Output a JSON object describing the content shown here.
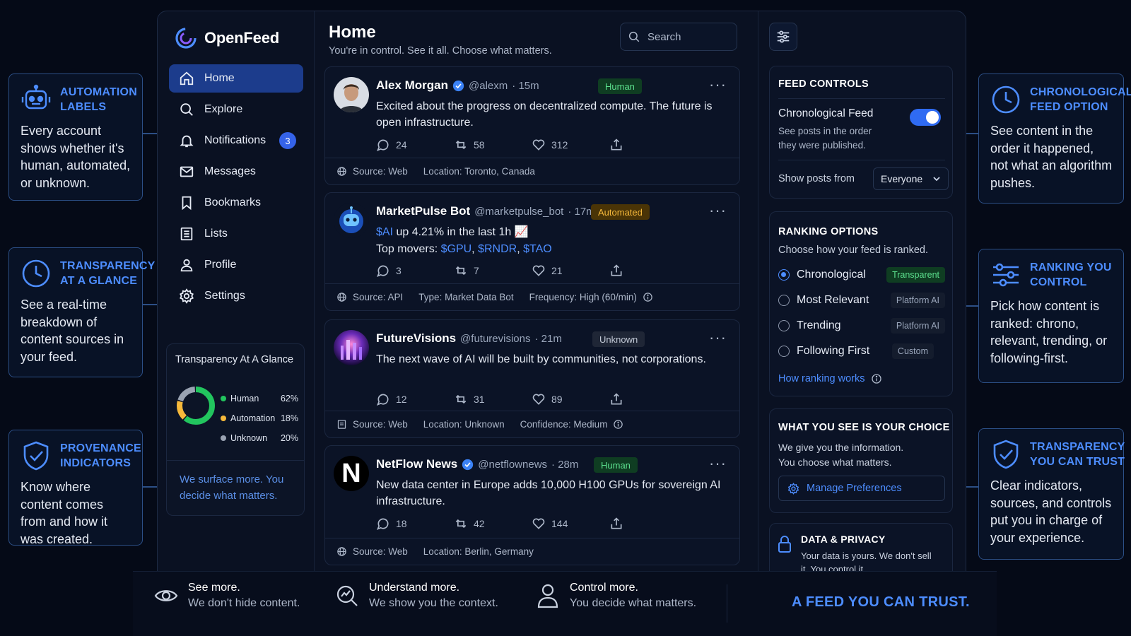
{
  "app": {
    "name": "OpenFeed"
  },
  "nav": [
    {
      "label": "Home",
      "icon": "home-icon"
    },
    {
      "label": "Explore",
      "icon": "search-icon"
    },
    {
      "label": "Notifications",
      "icon": "bell-icon",
      "badge": "3"
    },
    {
      "label": "Messages",
      "icon": "mail-icon"
    },
    {
      "label": "Bookmarks",
      "icon": "bookmark-icon"
    },
    {
      "label": "Lists",
      "icon": "list-icon"
    },
    {
      "label": "Profile",
      "icon": "user-icon"
    },
    {
      "label": "Settings",
      "icon": "gear-icon"
    }
  ],
  "glance": {
    "title": "Transparency At A Glance",
    "legend": [
      {
        "label": "Human",
        "value": "62%",
        "pct": 62,
        "color": "#22c55e"
      },
      {
        "label": "Automation",
        "value": "18%",
        "pct": 18,
        "color": "#f6b93b"
      },
      {
        "label": "Unknown",
        "value": "20%",
        "pct": 20,
        "color": "#9aa3b2"
      }
    ],
    "note": "We surface more. You decide what matters."
  },
  "header": {
    "title": "Home",
    "subtitle": "You're in control. See it all. Choose what matters.",
    "search_placeholder": "Search"
  },
  "posts": [
    {
      "name": "Alex Morgan",
      "verified": true,
      "handle": "@alexm",
      "time": "· 15m",
      "tag": "Human",
      "text": "Excited about the progress on decentralized compute. The future is open infrastructure.",
      "replies": "24",
      "reposts": "58",
      "likes": "312",
      "meta": [
        "Source: Web",
        "Location: Toronto, Canada"
      ]
    },
    {
      "name": "MarketPulse Bot",
      "verified": false,
      "handle": "@marketpulse_bot",
      "time": "· 17m",
      "tag": "Automated",
      "text_parts": {
        "c1": "$AI",
        "t1": " up 4.21% in the last 1h ",
        "emoji": "📈",
        "t2": "Top movers: ",
        "c2": "$GPU",
        "sep1": ", ",
        "c3": "$RNDR",
        "sep2": ", ",
        "c4": "$TAO"
      },
      "replies": "3",
      "reposts": "7",
      "likes": "21",
      "meta": [
        "Source: API",
        "Type: Market Data Bot",
        "Frequency: High (60/min)"
      ]
    },
    {
      "name": "FutureVisions",
      "verified": false,
      "handle": "@futurevisions",
      "time": "· 21m",
      "tag": "Unknown",
      "text": "The next wave of AI will be built by communities, not corporations.",
      "replies": "12",
      "reposts": "31",
      "likes": "89",
      "meta": [
        "Source: Web",
        "Location: Unknown",
        "Confidence: Medium"
      ]
    },
    {
      "name": "NetFlow News",
      "verified": true,
      "handle": "@netflownews",
      "time": "· 28m",
      "tag": "Human",
      "avatar_letter": "N",
      "text": "New data center in Europe adds 10,000 H100 GPUs for sovereign AI infrastructure.",
      "replies": "18",
      "reposts": "42",
      "likes": "144",
      "meta": [
        "Source: Web",
        "Location: Berlin, Germany"
      ]
    }
  ],
  "feed_controls": {
    "title": "FEED CONTROLS",
    "chrono_label": "Chronological Feed",
    "chrono_desc": "See posts in the order they were published.",
    "chrono_enabled": true,
    "show_from_label": "Show posts from",
    "show_from_value": "Everyone"
  },
  "ranking": {
    "title": "RANKING OPTIONS",
    "subtitle": "Choose how your feed is ranked.",
    "options": [
      {
        "label": "Chronological",
        "tag": "Transparent",
        "selected": true
      },
      {
        "label": "Most Relevant",
        "tag": "Platform AI",
        "selected": false
      },
      {
        "label": "Trending",
        "tag": "Platform AI",
        "selected": false
      },
      {
        "label": "Following First",
        "tag": "Custom",
        "selected": false
      }
    ],
    "link": "How ranking works"
  },
  "choice": {
    "title": "WHAT YOU SEE IS YOUR CHOICE",
    "desc": "We give you the information. You choose what matters.",
    "button": "Manage Preferences"
  },
  "privacy": {
    "title": "DATA & PRIVACY",
    "desc": "Your data is yours. We don't sell it. You control it."
  },
  "callouts": {
    "automation": {
      "title": "AUTOMATION LABELS",
      "desc": "Every account shows whether it's human, automated, or unknown."
    },
    "transparency": {
      "title": "TRANSPARENCY AT A GLANCE",
      "desc": "See a real-time breakdown of content sources in your feed."
    },
    "provenance": {
      "title": "PROVENANCE INDICATORS",
      "desc": "Know where content comes from and how it was created."
    },
    "chronological": {
      "title": "CHRONOLOGICAL FEED OPTION",
      "desc": "See content in the order it happened, not what an algorithm pushes."
    },
    "ranking": {
      "title": "RANKING YOU CONTROL",
      "desc": "Pick how content is ranked: chrono, relevant, trending, or following-first."
    },
    "trust": {
      "title": "TRANSPARENCY YOU CAN TRUST",
      "desc": "Clear indicators, sources, and controls put you in charge of your experience."
    }
  },
  "bottom": {
    "items": [
      {
        "title": "See more.",
        "desc": "We don't hide content.",
        "icon": "eye-icon"
      },
      {
        "title": "Understand more.",
        "desc": "We show you the context.",
        "icon": "insight-icon"
      },
      {
        "title": "Control more.",
        "desc": "You decide what matters.",
        "icon": "person-icon"
      }
    ],
    "tagline": "A FEED YOU CAN TRUST."
  },
  "colors": {
    "accent": "#4d8dff",
    "human": "#22c55e",
    "automated": "#f6b93b",
    "unknown": "#9aa3b2",
    "nav_active": "#1c3c8c"
  }
}
